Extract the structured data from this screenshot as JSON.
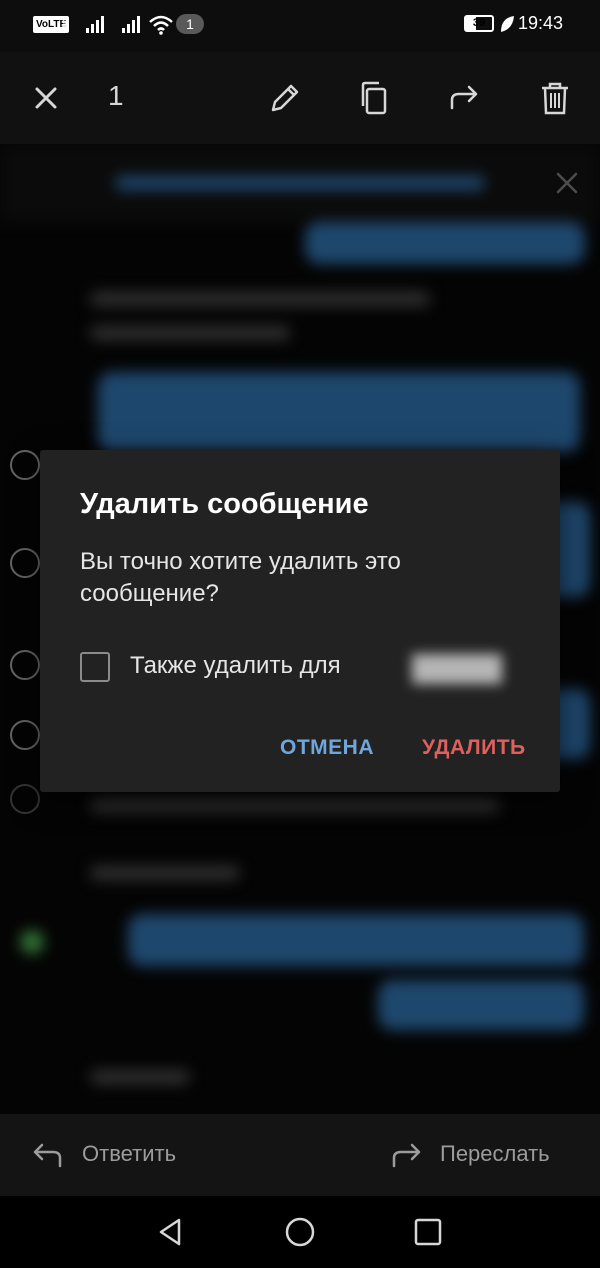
{
  "status_bar": {
    "volte": "VoLTE",
    "sim1": "1",
    "notification_count": "1",
    "battery_level": "39",
    "battery_fraction": 0.39,
    "time": "19:43"
  },
  "action_bar": {
    "selected_count": "1",
    "icons": [
      "close-icon",
      "edit-pencil-icon",
      "copy-icon",
      "forward-icon",
      "trash-icon"
    ]
  },
  "dialog": {
    "title": "Удалить сообщение",
    "message": "Вы точно хотите удалить это сообщение?",
    "checkbox_label": "Также удалить для",
    "checkbox_checked": false,
    "cancel_label": "ОТМЕНА",
    "delete_label": "УДАЛИТЬ",
    "cancel_color": "#6fa7dd",
    "delete_color": "#e0605f"
  },
  "bottom_bar": {
    "reply_label": "Ответить",
    "forward_label": "Переслать"
  },
  "nav_bar": {
    "icons": [
      "back-triangle-icon",
      "home-circle-icon",
      "recents-square-icon"
    ]
  },
  "colors": {
    "accent_blue": "#2f6ea8",
    "background": "#000000",
    "dialog_background": "#222222"
  }
}
